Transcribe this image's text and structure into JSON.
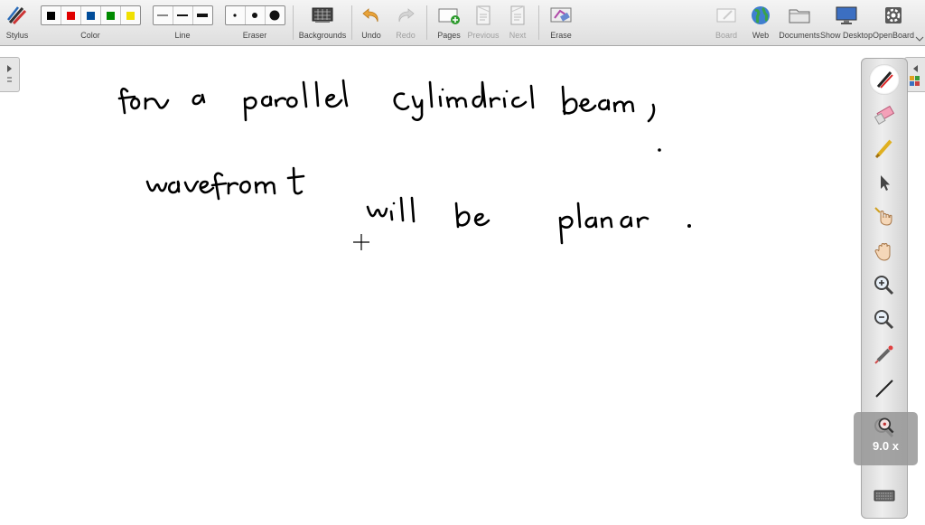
{
  "toolbar": {
    "stylus": "Stylus",
    "color": "Color",
    "colors": [
      "#000000",
      "#e00000",
      "#004c99",
      "#008a00",
      "#f0e000"
    ],
    "line": "Line",
    "eraser": "Eraser",
    "backgrounds": "Backgrounds",
    "undo": "Undo",
    "redo": "Redo",
    "pages": "Pages",
    "previous": "Previous",
    "next": "Next",
    "erase": "Erase",
    "board": "Board",
    "web": "Web",
    "documents": "Documents",
    "show_desktop": "Show Desktop",
    "openboard": "OpenBoard"
  },
  "zoom": {
    "value": "9.0 x"
  },
  "sidebar": {
    "tools": [
      "pen-icon",
      "eraser-icon",
      "marker-icon",
      "selector-icon",
      "interact-icon",
      "hand-icon",
      "zoom-in-icon",
      "zoom-out-icon",
      "laser-pointer-icon",
      "line-icon",
      "zoom-magnifier-icon",
      "keyboard-icon"
    ]
  },
  "board": {
    "handwriting": [
      "for a parallel cylindrical beam,",
      "wavefront will be planar."
    ]
  }
}
